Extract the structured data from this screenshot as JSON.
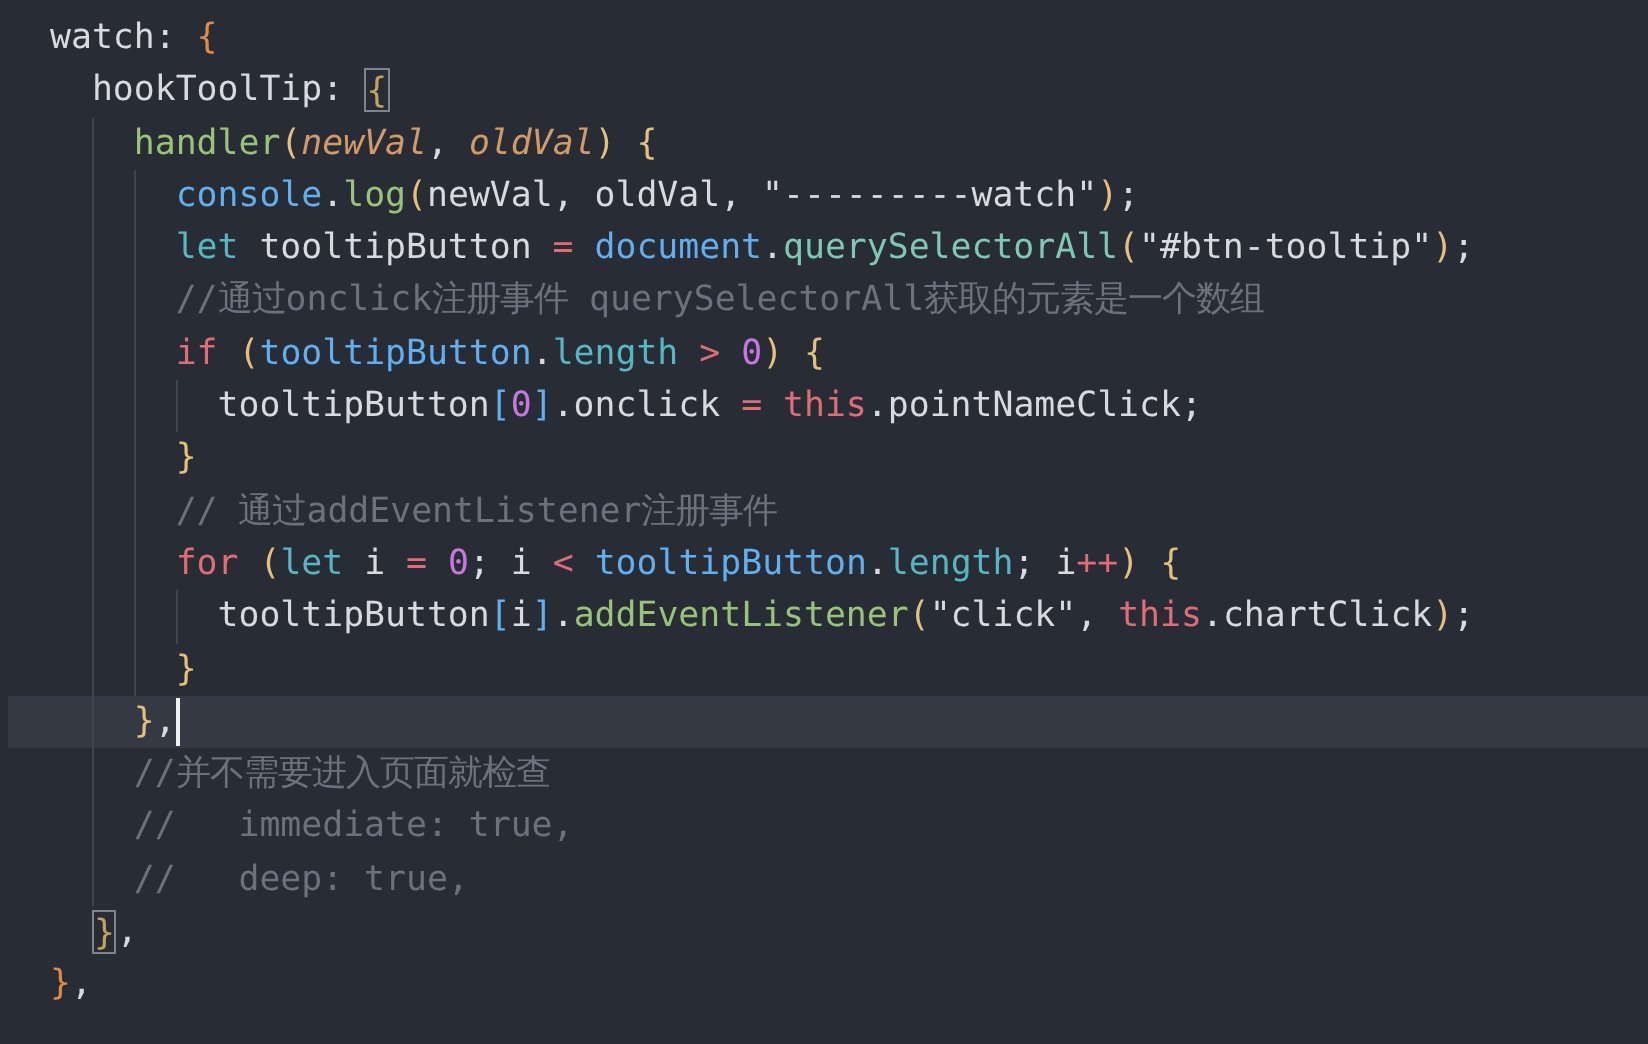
{
  "editor": {
    "lines": [
      {
        "selected": false,
        "tokens": [
          {
            "text": "watch: ",
            "kind": "plain"
          },
          {
            "text": "{",
            "kind": "brace-outer"
          }
        ]
      },
      {
        "selected": false,
        "tokens": [
          {
            "text": "  hookToolTip: ",
            "kind": "plain"
          },
          {
            "text": "{",
            "kind": "brace-match"
          }
        ]
      },
      {
        "selected": false,
        "tokens": [
          {
            "text": "    handler",
            "kind": "function"
          },
          {
            "text": "(",
            "kind": "brace"
          },
          {
            "text": "newVal",
            "kind": "param"
          },
          {
            "text": ", ",
            "kind": "plain"
          },
          {
            "text": "oldVal",
            "kind": "param"
          },
          {
            "text": ")",
            "kind": "brace"
          },
          {
            "text": " {",
            "kind": "brace"
          }
        ]
      },
      {
        "selected": false,
        "tokens": [
          {
            "text": "      console",
            "kind": "object"
          },
          {
            "text": ".",
            "kind": "plain"
          },
          {
            "text": "log",
            "kind": "function"
          },
          {
            "text": "(",
            "kind": "brace"
          },
          {
            "text": "newVal, oldVal, ",
            "kind": "plain"
          },
          {
            "text": "\"---------watch\"",
            "kind": "string"
          },
          {
            "text": ")",
            "kind": "brace"
          },
          {
            "text": ";",
            "kind": "plain"
          }
        ]
      },
      {
        "selected": false,
        "tokens": [
          {
            "text": "      let",
            "kind": "storage"
          },
          {
            "text": " tooltipButton ",
            "kind": "plain"
          },
          {
            "text": "= ",
            "kind": "operator"
          },
          {
            "text": "document",
            "kind": "object"
          },
          {
            "text": ".",
            "kind": "plain"
          },
          {
            "text": "querySelectorAll",
            "kind": "method"
          },
          {
            "text": "(",
            "kind": "brace"
          },
          {
            "text": "\"#btn-tooltip\"",
            "kind": "string"
          },
          {
            "text": ")",
            "kind": "brace"
          },
          {
            "text": ";",
            "kind": "plain"
          }
        ]
      },
      {
        "selected": false,
        "tokens": [
          {
            "text": "      //通过onclick注册事件 querySelectorAll获取的元素是一个数组",
            "kind": "comment"
          }
        ]
      },
      {
        "selected": false,
        "tokens": [
          {
            "text": "      if ",
            "kind": "keyword"
          },
          {
            "text": "(",
            "kind": "brace"
          },
          {
            "text": "tooltipButton",
            "kind": "object"
          },
          {
            "text": ".",
            "kind": "plain"
          },
          {
            "text": "length",
            "kind": "property"
          },
          {
            "text": " > ",
            "kind": "operator"
          },
          {
            "text": "0",
            "kind": "number"
          },
          {
            "text": ")",
            "kind": "brace"
          },
          {
            "text": " {",
            "kind": "brace"
          }
        ]
      },
      {
        "selected": false,
        "tokens": [
          {
            "text": "        tooltipButton",
            "kind": "plain"
          },
          {
            "text": "[",
            "kind": "bracket"
          },
          {
            "text": "0",
            "kind": "number"
          },
          {
            "text": "]",
            "kind": "bracket"
          },
          {
            "text": ".onclick ",
            "kind": "plain"
          },
          {
            "text": "= ",
            "kind": "operator"
          },
          {
            "text": "this",
            "kind": "keyword"
          },
          {
            "text": ".pointNameClick;",
            "kind": "plain"
          }
        ]
      },
      {
        "selected": false,
        "tokens": [
          {
            "text": "      }",
            "kind": "brace"
          }
        ]
      },
      {
        "selected": false,
        "tokens": [
          {
            "text": "      // 通过addEventListener注册事件",
            "kind": "comment"
          }
        ]
      },
      {
        "selected": false,
        "tokens": [
          {
            "text": "      for ",
            "kind": "keyword"
          },
          {
            "text": "(",
            "kind": "brace"
          },
          {
            "text": "let",
            "kind": "storage"
          },
          {
            "text": " i ",
            "kind": "plain"
          },
          {
            "text": "= ",
            "kind": "operator"
          },
          {
            "text": "0",
            "kind": "number"
          },
          {
            "text": "; i ",
            "kind": "plain"
          },
          {
            "text": "< ",
            "kind": "operator"
          },
          {
            "text": "tooltipButton",
            "kind": "object"
          },
          {
            "text": ".",
            "kind": "plain"
          },
          {
            "text": "length",
            "kind": "property"
          },
          {
            "text": "; i",
            "kind": "plain"
          },
          {
            "text": "++",
            "kind": "operator"
          },
          {
            "text": ")",
            "kind": "brace"
          },
          {
            "text": " {",
            "kind": "brace"
          }
        ]
      },
      {
        "selected": false,
        "tokens": [
          {
            "text": "        tooltipButton",
            "kind": "plain"
          },
          {
            "text": "[",
            "kind": "bracket"
          },
          {
            "text": "i",
            "kind": "plain"
          },
          {
            "text": "]",
            "kind": "bracket"
          },
          {
            "text": ".",
            "kind": "plain"
          },
          {
            "text": "addEventListener",
            "kind": "function"
          },
          {
            "text": "(",
            "kind": "brace"
          },
          {
            "text": "\"click\"",
            "kind": "string"
          },
          {
            "text": ", ",
            "kind": "plain"
          },
          {
            "text": "this",
            "kind": "keyword"
          },
          {
            "text": ".chartClick",
            "kind": "plain"
          },
          {
            "text": ")",
            "kind": "brace"
          },
          {
            "text": ";",
            "kind": "plain"
          }
        ]
      },
      {
        "selected": false,
        "tokens": [
          {
            "text": "      }",
            "kind": "brace"
          }
        ]
      },
      {
        "selected": true,
        "tokens": [
          {
            "text": "    }",
            "kind": "brace"
          },
          {
            "text": ",",
            "kind": "plain"
          }
        ]
      },
      {
        "selected": false,
        "tokens": [
          {
            "text": "    //并不需要进入页面就检查",
            "kind": "comment"
          }
        ]
      },
      {
        "selected": false,
        "tokens": [
          {
            "text": "    //   immediate: true,",
            "kind": "comment"
          }
        ]
      },
      {
        "selected": false,
        "tokens": [
          {
            "text": "    //   deep: true,",
            "kind": "comment"
          }
        ]
      },
      {
        "selected": false,
        "tokens": [
          {
            "text": "  }",
            "kind": "brace-match"
          },
          {
            "text": ",",
            "kind": "plain"
          }
        ]
      },
      {
        "selected": false,
        "tokens": [
          {
            "text": "}",
            "kind": "brace-outer"
          },
          {
            "text": ",",
            "kind": "plain"
          }
        ]
      }
    ]
  }
}
